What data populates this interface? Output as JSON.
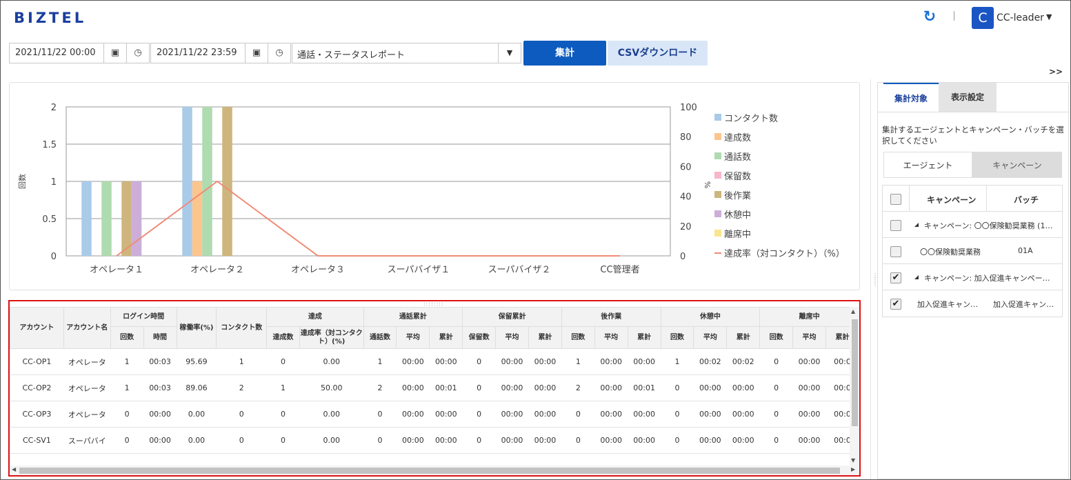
{
  "header": {
    "logo": "BIZTEL",
    "refresh_icon": "refresh-icon",
    "avatar_letter": "C",
    "user_name": "CC-leader"
  },
  "toolbar": {
    "start_datetime": "2021/11/22 00:00",
    "end_datetime": "2021/11/22 23:59",
    "report_type": "通話・ステータスレポート",
    "aggregate_label": "集計",
    "csv_label": "CSVダウンロード",
    "expand_label": ">>"
  },
  "colors": {
    "brand": "#1a3f9c",
    "primary_button": "#0d5bbf",
    "secondary_button": "#d9e6f7",
    "highlight_border": "#dd1111"
  },
  "chart_data": {
    "type": "bar",
    "categories": [
      "オペレータ１",
      "オペレータ２",
      "オペレータ３",
      "スーパバイザ１",
      "スーパバイザ２",
      "CC管理者"
    ],
    "ylabel": "回数",
    "y2label": "%",
    "ylim": [
      0,
      2
    ],
    "y2lim": [
      0,
      100
    ],
    "yticks": [
      "0",
      "0.5",
      "1",
      "1.5",
      "2"
    ],
    "y2ticks": [
      "0",
      "20",
      "40",
      "60",
      "80",
      "100"
    ],
    "grid": true,
    "legend_position": "right",
    "series": [
      {
        "name": "コンタクト数",
        "color": "#a9cbe8",
        "values": [
          1,
          2,
          0,
          0,
          0,
          0
        ]
      },
      {
        "name": "達成数",
        "color": "#fdc58e",
        "values": [
          0,
          1,
          0,
          0,
          0,
          0
        ]
      },
      {
        "name": "通話数",
        "color": "#afdbb0",
        "values": [
          1,
          2,
          0,
          0,
          0,
          0
        ]
      },
      {
        "name": "保留数",
        "color": "#f8b6c8",
        "values": [
          0,
          0,
          0,
          0,
          0,
          0
        ]
      },
      {
        "name": "後作業",
        "color": "#cdb57d",
        "values": [
          1,
          2,
          0,
          0,
          0,
          0
        ]
      },
      {
        "name": "休憩中",
        "color": "#ccaed9",
        "values": [
          1,
          0,
          0,
          0,
          0,
          0
        ]
      },
      {
        "name": "離席中",
        "color": "#f9e58f",
        "values": [
          0,
          0,
          0,
          0,
          0,
          0
        ]
      }
    ],
    "line_series": {
      "name": "達成率（対コンタクト）（%）",
      "color": "#ef8b76",
      "axis": "right",
      "values": [
        0,
        50,
        0,
        0,
        0,
        0
      ]
    }
  },
  "table": {
    "headers_top": {
      "account": "アカウント",
      "account_name": "アカウント名",
      "login_time": "ログイン時間",
      "utilization": "稼働率(%)",
      "contacts": "コンタクト数",
      "achievement": "達成",
      "talk_total": "通話累計",
      "hold_total": "保留累計",
      "after_work": "後作業",
      "break": "休憩中",
      "away": "離席中"
    },
    "headers_sub": {
      "count": "回数",
      "time": "時間",
      "achieved": "達成数",
      "achieve_rate": "達成率（対コンタクト）(%)",
      "talk_count": "通話数",
      "hold_count": "保留数",
      "avg": "平均",
      "total": "累計"
    },
    "rows": [
      [
        "CC-OP1",
        "オペレータ",
        "1",
        "00:03",
        "95.69",
        "1",
        "0",
        "0.00",
        "1",
        "00:00",
        "00:00",
        "0",
        "00:00",
        "00:00",
        "1",
        "00:00",
        "00:00",
        "1",
        "00:02",
        "00:02",
        "0",
        "00:00",
        "00:0"
      ],
      [
        "CC-OP2",
        "オペレータ",
        "1",
        "00:03",
        "89.06",
        "2",
        "1",
        "50.00",
        "2",
        "00:00",
        "00:01",
        "0",
        "00:00",
        "00:00",
        "2",
        "00:00",
        "00:01",
        "0",
        "00:00",
        "00:00",
        "0",
        "00:00",
        "00:0"
      ],
      [
        "CC-OP3",
        "オペレータ",
        "0",
        "00:00",
        "0.00",
        "0",
        "0",
        "0.00",
        "0",
        "00:00",
        "00:00",
        "0",
        "00:00",
        "00:00",
        "0",
        "00:00",
        "00:00",
        "0",
        "00:00",
        "00:00",
        "0",
        "00:00",
        "00:0"
      ],
      [
        "CC-SV1",
        "スーパバイ",
        "0",
        "00:00",
        "0.00",
        "0",
        "0",
        "0.00",
        "0",
        "00:00",
        "00:00",
        "0",
        "00:00",
        "00:00",
        "0",
        "00:00",
        "00:00",
        "0",
        "00:00",
        "00:00",
        "0",
        "00:00",
        "00:0"
      ]
    ]
  },
  "sidebar": {
    "tab_target": "集計対象",
    "tab_display": "表示設定",
    "description": "集計するエージェントとキャンペーン・バッチを選択してください",
    "subtab_agent": "エージェント",
    "subtab_campaign": "キャンペーン",
    "col_campaign": "キャンペーン",
    "col_batch": "バッチ",
    "items": [
      {
        "type": "group",
        "checked": false,
        "label": "キャンペーン: 〇〇保険勧奨業務 (1…"
      },
      {
        "type": "item",
        "checked": false,
        "campaign": "〇〇保険勧奨業務",
        "batch": "01A"
      },
      {
        "type": "group",
        "checked": true,
        "label": "キャンペーン: 加入促進キャンペー…"
      },
      {
        "type": "item",
        "checked": true,
        "campaign": "加入促進キャン…",
        "batch": "加入促進キャン…"
      }
    ]
  }
}
